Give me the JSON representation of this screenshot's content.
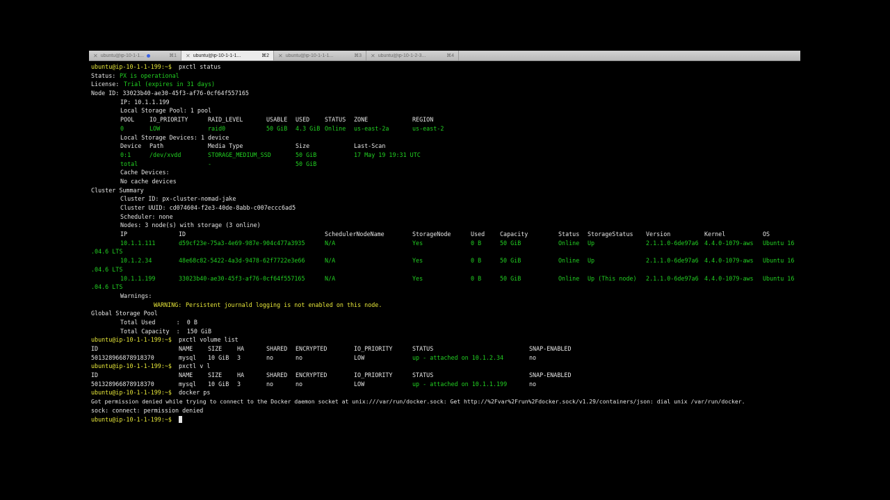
{
  "tabs": [
    {
      "label": "ubuntu@ip-10-1-1...",
      "shortcut": "⌘1",
      "active": false,
      "activity_dot": true
    },
    {
      "label": "ubuntu@ip-10-1-1-1...",
      "shortcut": "⌘2",
      "active": true,
      "activity_dot": false
    },
    {
      "label": "ubuntu@ip-10-1-1-1...",
      "shortcut": "⌘3",
      "active": false,
      "activity_dot": false
    },
    {
      "label": "ubuntu@ip-10-1-2-3...",
      "shortcut": "⌘4",
      "active": false,
      "activity_dot": false
    }
  ],
  "prompt": "ubuntu@ip-10-1-1-199:~$",
  "commands": {
    "c1": "pxctl status",
    "c2": "pxctl volume list",
    "c3": "pxctl v l",
    "c4": "docker ps"
  },
  "status": {
    "status_key": "Status:",
    "status_val": "PX is operational",
    "license_key": "License:",
    "license_val": "Trial (expires in 31 days)",
    "node_id": "Node ID: 33023b40-ae30-45f3-af76-0cf64f557165",
    "ip": "IP: 10.1.1.199",
    "local_pool": "Local Storage Pool: 1 pool",
    "pool_headers": [
      "POOL",
      "IO_PRIORITY",
      "RAID_LEVEL",
      "USABLE",
      "USED",
      "STATUS",
      "ZONE",
      "REGION"
    ],
    "pool_row": [
      "0",
      "LOW",
      "raid0",
      "50 GiB",
      "4.3 GiB",
      "Online",
      "us-east-2a",
      "us-east-2"
    ],
    "local_devices": "Local Storage Devices: 1 device",
    "dev_headers": [
      "Device",
      "Path",
      "Media Type",
      "Size",
      "Last-Scan"
    ],
    "dev_row": [
      "0:1",
      "/dev/xvdd",
      "STORAGE_MEDIUM_SSD",
      "50 GiB",
      "17 May 19 19:31 UTC"
    ],
    "total_row": [
      "total",
      "-",
      "50 GiB"
    ],
    "cache_devices": "Cache Devices:",
    "no_cache": "No cache devices",
    "cluster_summary": "Cluster Summary",
    "cluster_id": "Cluster ID: px-cluster-nomad-jake",
    "cluster_uuid": "Cluster UUID: cd074604-f2e3-40de-8abb-c007eccc6ad5",
    "scheduler": "Scheduler: none",
    "nodes": "Nodes: 3 node(s) with storage (3 online)",
    "node_headers": [
      "IP",
      "ID",
      "SchedulerNodeName",
      "StorageNode",
      "Used",
      "Capacity",
      "Status",
      "StorageStatus",
      "Version",
      "Kernel",
      "OS"
    ],
    "node_rows": [
      [
        "10.1.1.111",
        "d59cf23e-75a3-4e69-987e-904c477a3935",
        "N/A",
        "Yes",
        "0 B",
        "50 GiB",
        "Online",
        "Up",
        "2.1.1.0-6de97a6",
        "4.4.0-1079-aws",
        "Ubuntu 16"
      ],
      [
        "10.1.2.34",
        "48e68c82-5422-4a3d-9478-62f7722e3e66",
        "N/A",
        "Yes",
        "0 B",
        "50 GiB",
        "Online",
        "Up",
        "2.1.1.0-6de97a6",
        "4.4.0-1079-aws",
        "Ubuntu 16"
      ],
      [
        "10.1.1.199",
        "33023b40-ae30-45f3-af76-0cf64f557165",
        "N/A",
        "Yes",
        "0 B",
        "50 GiB",
        "Online",
        "Up (This node)",
        "2.1.1.0-6de97a6",
        "4.4.0-1079-aws",
        "Ubuntu 16"
      ]
    ],
    "os_wrap": ".04.6 LTS",
    "warnings": "Warnings:",
    "warning_label": "WARNING:",
    "warning_text": "Persistent journald logging is not enabled on this node.",
    "global_pool": "Global Storage Pool",
    "total_used": "Total Used      :  0 B",
    "total_capacity": "Total Capacity  :  150 GiB"
  },
  "volume_list": {
    "headers": [
      "ID",
      "NAME",
      "SIZE",
      "HA",
      "SHARED",
      "ENCRYPTED",
      "IO_PRIORITY",
      "STATUS",
      "SNAP-ENABLED"
    ],
    "row1": [
      "501328966878918370",
      "mysql",
      "10 GiB",
      "3",
      "no",
      "no",
      "LOW",
      "up - attached on 10.1.2.34",
      "no"
    ],
    "row2": [
      "501328966878918370",
      "mysql",
      "10 GiB",
      "3",
      "no",
      "no",
      "LOW",
      "up - attached on 10.1.1.199",
      "no"
    ]
  },
  "docker_error": {
    "line1": "Got permission denied while trying to connect to the Docker daemon socket at unix:///var/run/docker.sock: Get http://%2Fvar%2Frun%2Fdocker.sock/v1.29/containers/json: dial unix /var/run/docker.",
    "line2": "sock: connect: permission denied"
  }
}
